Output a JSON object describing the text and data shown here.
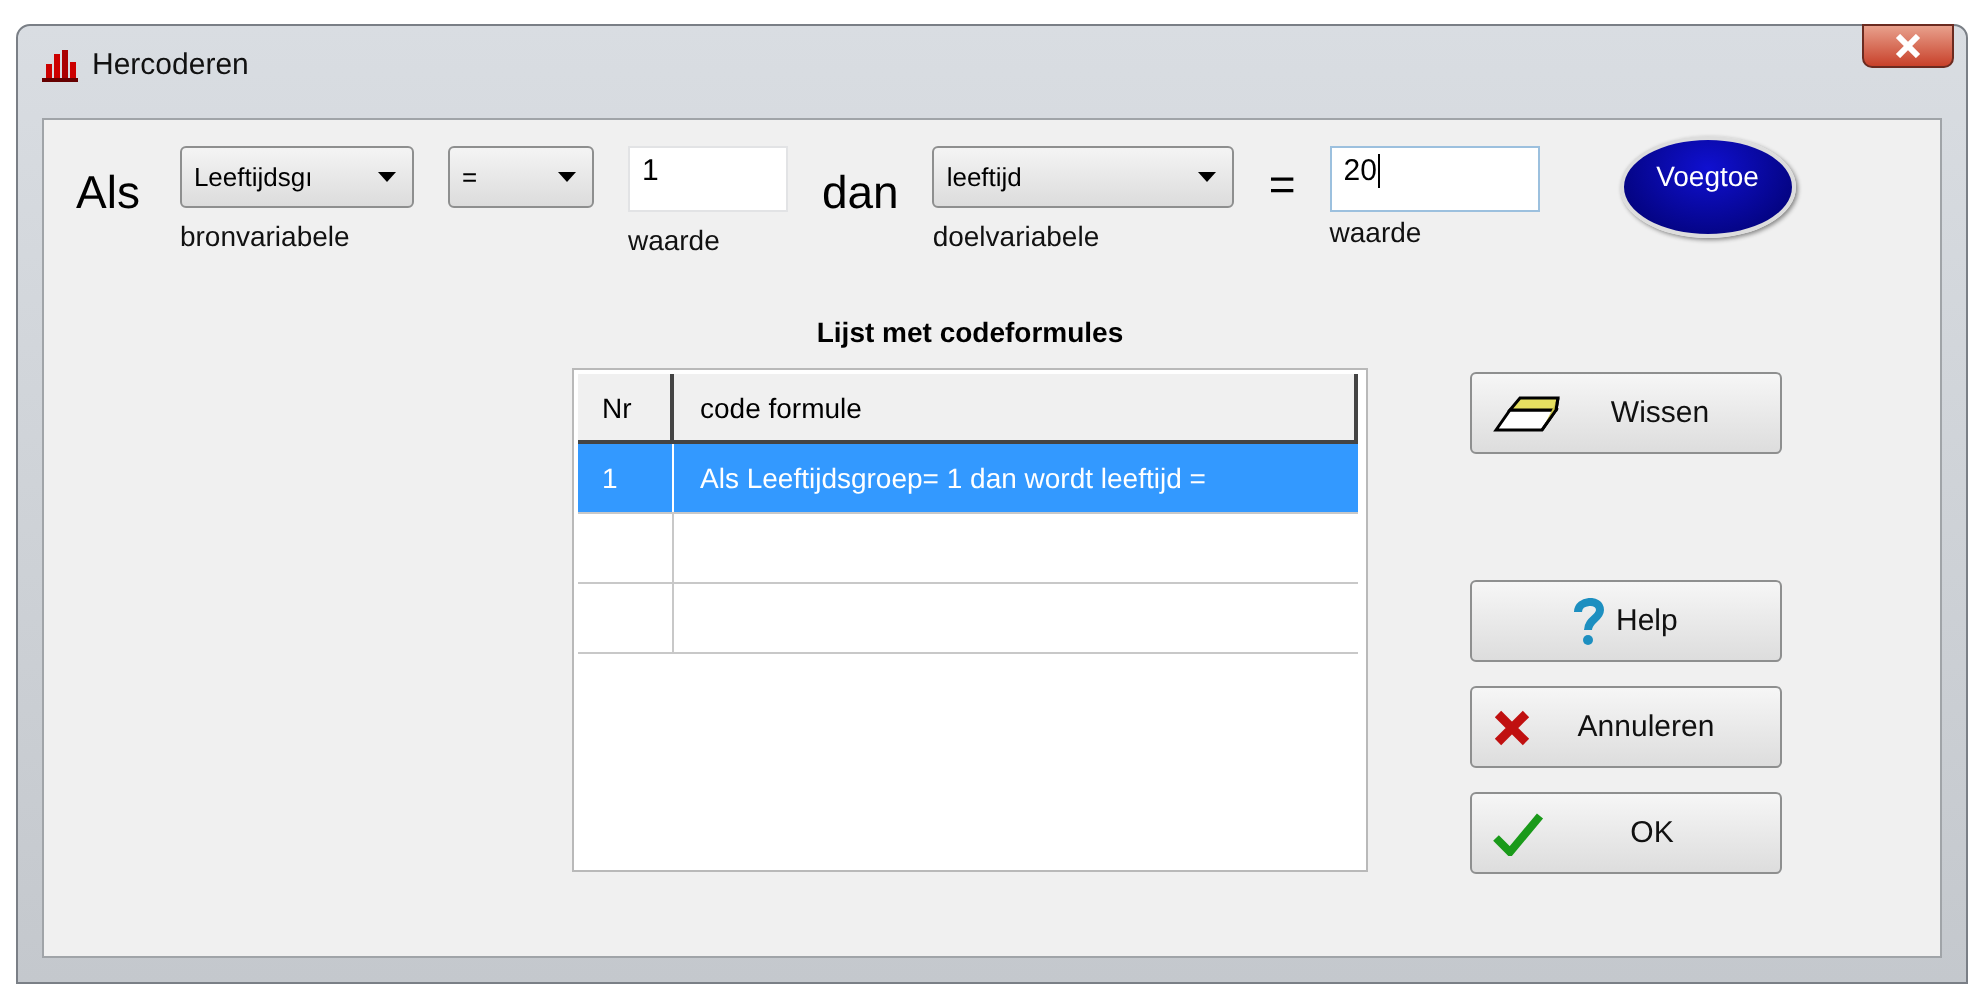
{
  "window": {
    "title": "Hercoderen"
  },
  "rule": {
    "if_word": "Als",
    "then_word": "dan",
    "equals_sign": "=",
    "source": {
      "value": "Leeftijdsgı",
      "label": "bronvariabele"
    },
    "operator": {
      "value": "="
    },
    "source_value": {
      "value": "1",
      "label": "waarde"
    },
    "target": {
      "value": "leeftijd",
      "label": "doelvariabele"
    },
    "target_value": {
      "value": "20",
      "label": "waarde"
    },
    "add_button": "Voegtoe"
  },
  "table": {
    "title": "Lijst met codeformules",
    "columns": [
      "Nr",
      "code formule"
    ],
    "rows": [
      {
        "nr": "1",
        "formula": "Als  Leeftijdsgroep= 1 dan wordt leeftijd  =",
        "selected": true
      },
      {
        "selected": false
      },
      {
        "selected": false
      }
    ]
  },
  "buttons": [
    {
      "kind": "eraser",
      "label": "Wissen"
    },
    {
      "kind": "help",
      "label": "Help"
    },
    {
      "kind": "cancel",
      "label": "Annuleren"
    },
    {
      "kind": "ok",
      "label": "OK"
    }
  ]
}
